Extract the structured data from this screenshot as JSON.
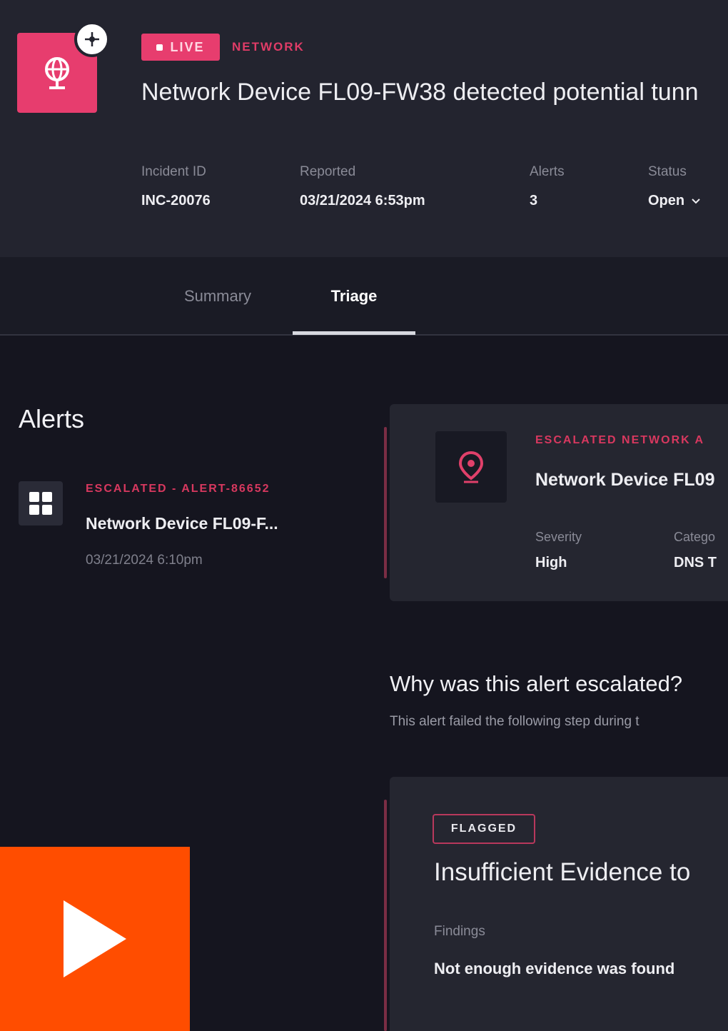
{
  "incident": {
    "live_label": "LIVE",
    "category": "NETWORK",
    "title": "Network Device FL09-FW38 detected potential tunn",
    "meta": [
      {
        "label": "Incident ID",
        "value": "INC-20076"
      },
      {
        "label": "Reported",
        "value": "03/21/2024 6:53pm"
      },
      {
        "label": "Alerts",
        "value": "3"
      },
      {
        "label": "Status",
        "value": "Open"
      }
    ]
  },
  "tabs": [
    {
      "label": "Summary",
      "active": false
    },
    {
      "label": "Triage",
      "active": true
    }
  ],
  "alerts": {
    "heading": "Alerts",
    "items": [
      {
        "status": "ESCALATED - ALERT-86652",
        "title": "Network Device FL09-F...",
        "time": "03/21/2024 6:10pm"
      }
    ]
  },
  "detail": {
    "status": "ESCALATED NETWORK A",
    "title": "Network Device FL09",
    "fields": [
      {
        "label": "Severity",
        "value": "High"
      },
      {
        "label": "Catego",
        "value": "DNS T"
      }
    ]
  },
  "escalation": {
    "heading": "Why was this alert escalated?",
    "subtext": "This alert failed the following step during t"
  },
  "finding": {
    "badge": "FLAGGED",
    "title": "Insufficient Evidence to",
    "findings_label": "Findings",
    "findings_text": "Not enough evidence was found"
  },
  "colors": {
    "accent": "#e73d6e",
    "escalated": "#d8385f",
    "play": "#ff4d00"
  },
  "icons": {
    "incident": "globe-icon",
    "ai_badge": "ai-chip-icon",
    "alert_item": "grid-icon",
    "detail": "location-pin-icon",
    "status_dropdown": "chevron-down-icon",
    "play": "play-icon"
  }
}
